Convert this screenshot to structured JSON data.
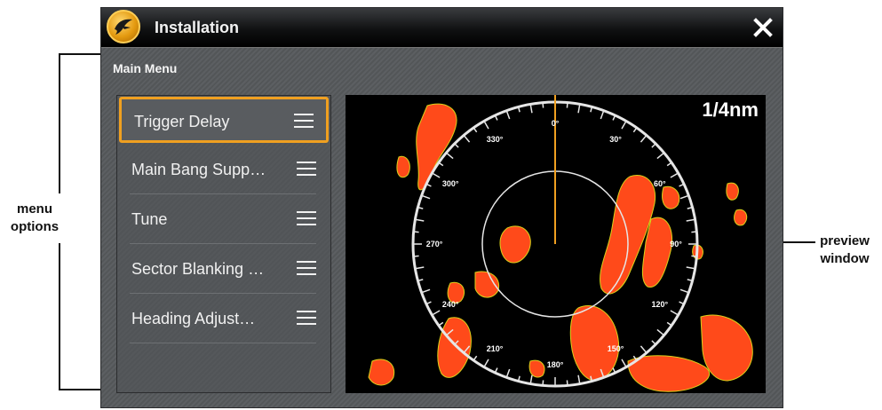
{
  "annotations": {
    "menu_options": "menu\noptions",
    "preview_window": "preview\nwindow"
  },
  "window": {
    "title": "Installation",
    "section_title": "Main Menu",
    "close_icon": "close-icon",
    "logo_icon": "humminbird-logo-icon"
  },
  "menu": {
    "items": [
      {
        "label": "Trigger Delay",
        "selected": true
      },
      {
        "label": "Main Bang Supp…",
        "selected": false
      },
      {
        "label": "Tune",
        "selected": false
      },
      {
        "label": "Sector Blanking …",
        "selected": false
      },
      {
        "label": "Heading Adjust…",
        "selected": false
      }
    ]
  },
  "radar": {
    "range": "1/4nm",
    "bearing_labels": [
      "0°",
      "30°",
      "60°",
      "90°",
      "120°",
      "150°",
      "180°",
      "210°",
      "240°",
      "270°",
      "300°",
      "330°"
    ],
    "colors": {
      "echo": "#ff4a1a",
      "echo_edge": "#d9d21a",
      "ring": "#e6e6e6",
      "heading_line": "#f0a020",
      "selection": "#f0a020"
    }
  }
}
